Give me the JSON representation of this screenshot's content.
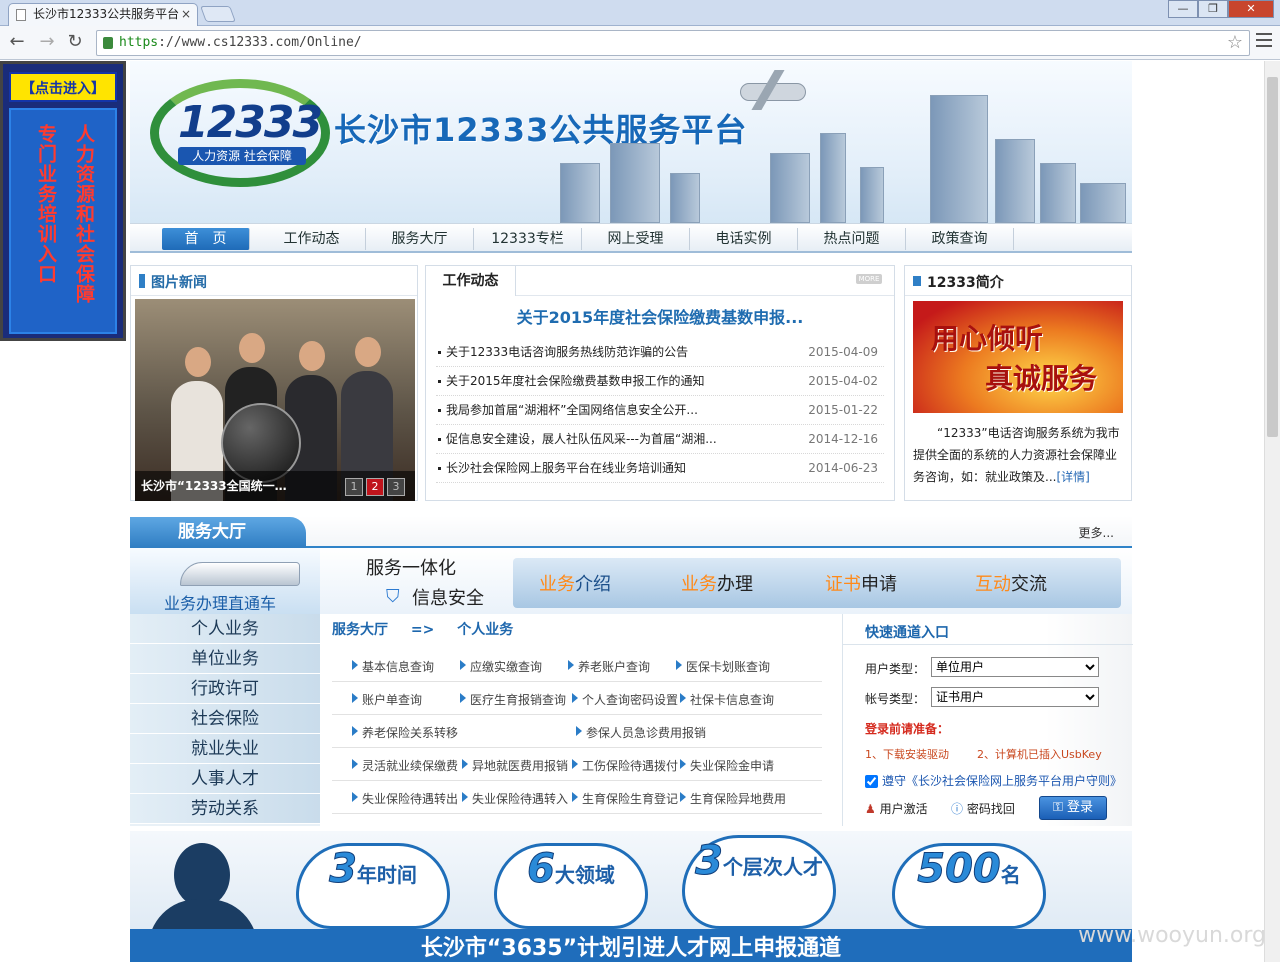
{
  "browser": {
    "tab_title": "长沙市12333公共服务平台",
    "tab_close": "×",
    "url_scheme": "https",
    "url_rest": "://www.cs12333.com/Online/",
    "win_min": "—",
    "win_max": "❐",
    "win_close": "✕"
  },
  "float_ad": {
    "top": "【点击进入】",
    "col_left": "人力资源和社会保障",
    "col_right": "专门业务培训入口"
  },
  "header": {
    "logo_number": "12333",
    "logo_tagline": "人力资源 社会保障",
    "site_title": "长沙市12333公共服务平台"
  },
  "nav": [
    "首　页",
    "工作动态",
    "服务大厅",
    "12333专栏",
    "网上受理",
    "电话实例",
    "热点问题",
    "政策查询"
  ],
  "photo_news": {
    "title": "图片新闻",
    "caption": "长沙市“12333全国统一…",
    "pages": [
      "1",
      "2",
      "3"
    ]
  },
  "work_news": {
    "tab": "工作动态",
    "more": "MORE",
    "headline": "关于2015年度社会保险缴费基数申报...",
    "items": [
      {
        "title": "关于12333电话咨询服务热线防范诈骗的公告",
        "date": "2015-04-09"
      },
      {
        "title": "关于2015年度社会保险缴费基数申报工作的通知",
        "date": "2015-04-02"
      },
      {
        "title": "我局参加首届“湖湘杯”全国网络信息安全公开...",
        "date": "2015-01-22"
      },
      {
        "title": "促信息安全建设，展人社队伍风采---为首届“湖湘...",
        "date": "2014-12-16"
      },
      {
        "title": "长沙社会保险网上服务平台在线业务培训通知",
        "date": "2014-06-23"
      }
    ]
  },
  "intro": {
    "title": "12333简介",
    "img_line1": "用心倾听",
    "img_line2": "真诚服务",
    "text": "“12333”电话咨询服务系统为我市提供全面的系统的人力资源社会保障业务咨询，如：就业政策及...",
    "detail": "[详情]"
  },
  "service": {
    "bar_title": "服务大厅",
    "more": "更多...",
    "train_label": "业务办理直通车",
    "slogan1": "服务一体化",
    "slogan2": "信息安全",
    "tabs": [
      {
        "hl": "业务",
        "rest": "介绍"
      },
      {
        "hl": "业务",
        "rest": "办理"
      },
      {
        "hl": "证书",
        "rest": "申请"
      },
      {
        "hl": "互动",
        "rest": "交流"
      }
    ],
    "left_menu": [
      "个人业务",
      "单位业务",
      "行政许可",
      "社会保险",
      "就业失业",
      "人事人才",
      "劳动关系"
    ],
    "crumb": [
      "服务大厅",
      "=>",
      "个人业务"
    ],
    "links": [
      [
        "基本信息查询",
        "应缴实缴查询",
        "养老账户查询",
        "医保卡划账查询"
      ],
      [
        "账户单查询",
        "医疗生育报销查询",
        "个人查询密码设置",
        "社保卡信息查询"
      ],
      [
        "养老保险关系转移",
        "参保人员急诊费用报销"
      ],
      [
        "灵活就业续保缴费",
        "异地就医费用报销",
        "工伤保险待遇拨付",
        "失业保险金申请"
      ],
      [
        "失业保险待遇转出",
        "失业保险待遇转入",
        "生育保险生育登记",
        "生育保险异地费用"
      ]
    ]
  },
  "quick": {
    "title": "快速通道入口",
    "user_type_label": "用户类型：",
    "user_type_value": "单位用户",
    "account_type_label": "帐号类型：",
    "account_type_value": "证书用户",
    "prep_title": "登录前请准备：",
    "step1": "1、下载安装驱动",
    "step2": "2、计算机已插入UsbKey",
    "agree": "遵守《长沙社会保险网上服务平台用户守则》",
    "activate": "用户激活",
    "recover": "密码找回",
    "login": "登录"
  },
  "bottom": {
    "clouds": [
      {
        "big": "3",
        "small": "年时间"
      },
      {
        "big": "6",
        "small": "大领域"
      },
      {
        "big": "3",
        "small": "个层次人才"
      },
      {
        "big": "500",
        "small": "名"
      }
    ],
    "stripe": "长沙市“3635”计划引进人才网上申报通道"
  },
  "watermark": "www.wooyun.org"
}
